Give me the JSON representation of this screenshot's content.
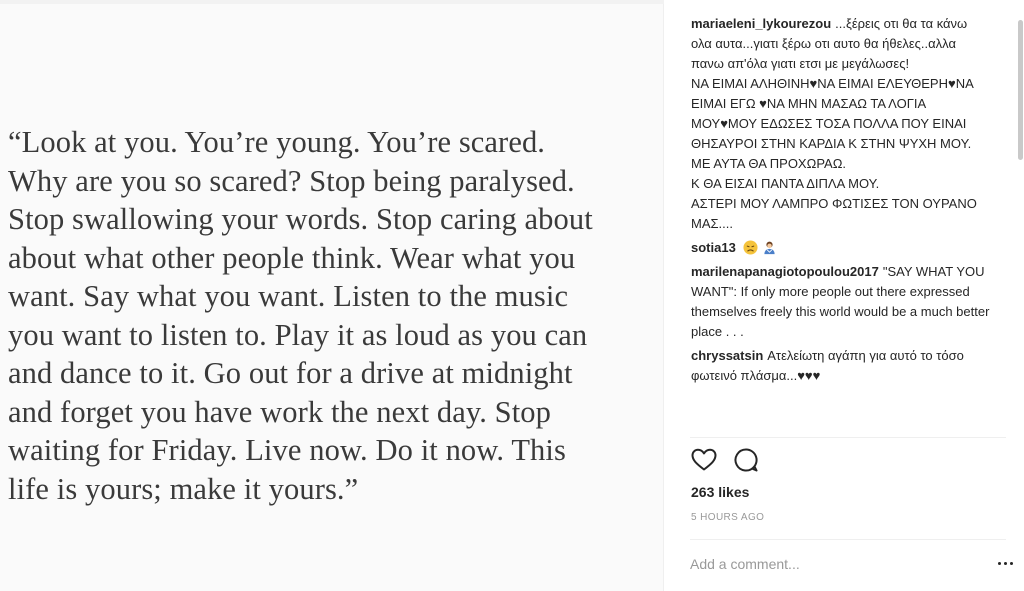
{
  "post_image": {
    "quote": "“Look at you. You’re young. You’re scared.\nWhy are you so scared? Stop being paralysed.\nStop swallowing your words. Stop caring about\nabout what other people think. Wear what you\nwant. Say what you want. Listen to the music\nyou want to listen to. Play it as loud as you can\nand dance to it. Go out for a drive at midnight\nand forget you have work the next day. Stop\nwaiting for Friday. Live now. Do it now. This\nlife is yours; make it yours.”"
  },
  "comments": [
    {
      "user": "mariaeleni_lykourezou",
      "text": "...ξέρεις οτι θα τα κάνω ολα αυτα...γιατι ξέρω οτι αυτο θα ήθελες..αλλα πανω απ'όλα γιατι ετσι με μεγάλωσες!\nΝΑ ΕΙΜΑΙ ΑΛΗΘΙΝΗ♥ΝΑ ΕΙΜΑΙ ΕΛΕΥΘΕΡΗ♥ΝΑ ΕΙΜΑΙ ΕΓΩ ♥ΝΑ ΜΗΝ ΜΑΣΑΩ ΤΑ ΛΟΓΙΑ ΜΟΥ♥ΜΟΥ ΕΔΩΣΕΣ ΤΟΣΑ ΠΟΛΛΑ ΠΟΥ ΕΙΝΑΙ ΘΗΣΑΥΡΟΙ ΣΤΗΝ ΚΑΡΔΙΑ Κ ΣΤΗΝ ΨΥΧΗ ΜΟΥ. ΜΕ ΑΥΤΑ ΘΑ ΠΡΟΧΩΡΑΩ.\nΚ ΘΑ ΕΙΣΑΙ ΠΑΝΤΑ ΔΙΠΛΑ ΜΟΥ.\nΑΣΤΕΡΙ ΜΟΥ ΛΑΜΠΡΟ ΦΩΤΙΣΕΣ ΤΟΝ ΟΥΡΑΝΟ ΜΑΣ...."
    },
    {
      "user": "sotia13",
      "text": "",
      "emojis": [
        "disappointed-face",
        "person-bowing"
      ]
    },
    {
      "user": "marilenapanagiotopoulou2017",
      "text": "\"SAY WHAT YOU WANT\": If only more people out there expressed themselves freely this world would be a much better place . . ."
    },
    {
      "user": "chryssatsin",
      "text": "Ατελείωτη αγάπη για αυτό το τόσο φωτεινό πλάσμα...♥♥♥"
    }
  ],
  "actions": {
    "like_icon": "heart-outline-icon",
    "comment_icon": "speech-bubble-icon"
  },
  "likes": "263 likes",
  "timestamp": "5 HOURS AGO",
  "add_comment": {
    "placeholder": "Add a comment..."
  },
  "colors": {
    "text": "#262626",
    "muted": "#999999",
    "quote": "#3a3a3a",
    "divider": "#efefef"
  }
}
